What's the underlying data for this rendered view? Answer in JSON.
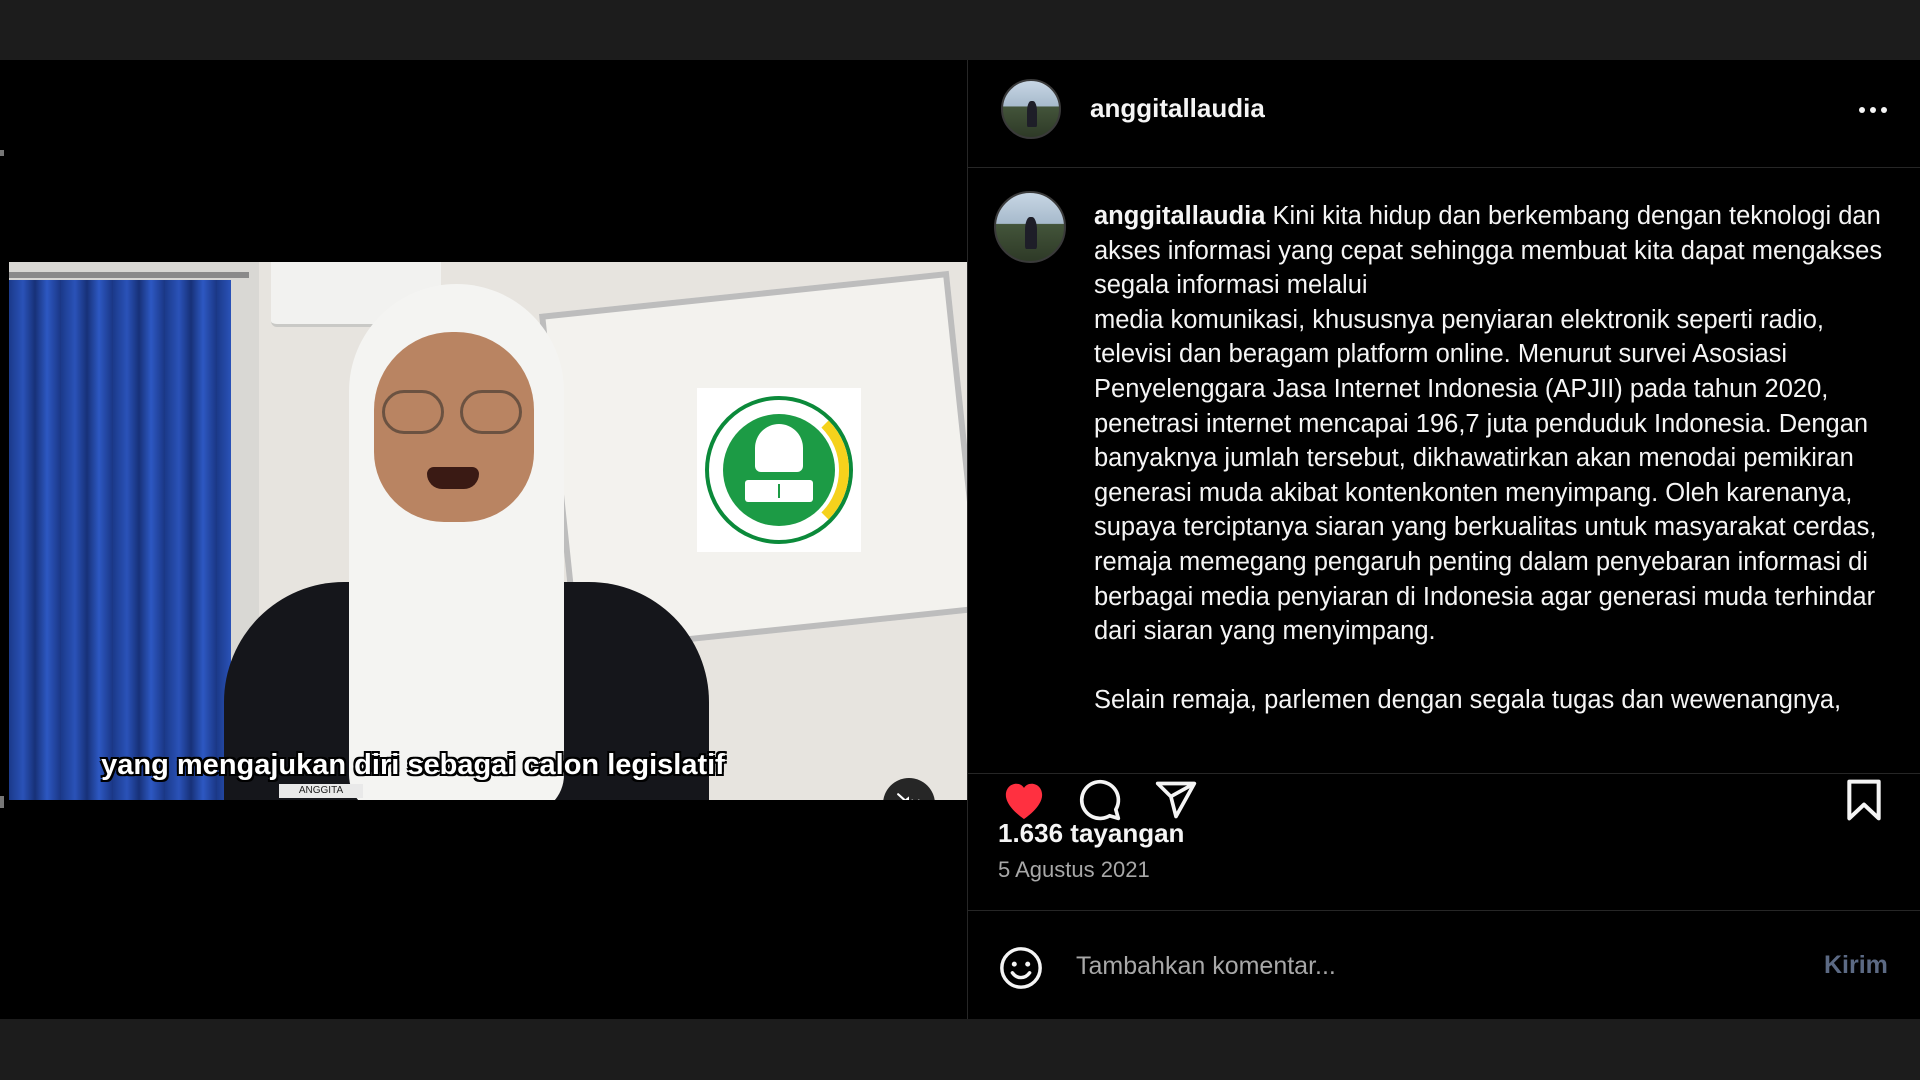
{
  "video": {
    "subtitle": "yang mengajukan diri sebagai calon legislatif",
    "name_tag": "ANGGITA ALLAUDIA",
    "mute_icon": "speaker-muted-icon"
  },
  "post": {
    "username": "anggitallaudia",
    "more_icon": "more-horizontal-icon",
    "caption": {
      "username": "anggitallaudia",
      "paragraph1": "Kini kita hidup dan berkembang dengan teknologi dan akses informasi yang cepat sehingga membuat kita dapat mengakses segala informasi melalui\nmedia komunikasi, khususnya penyiaran elektronik seperti radio, televisi dan beragam platform online. Menurut survei Asosiasi Penyelenggara Jasa Internet Indonesia (APJII) pada tahun 2020, penetrasi internet mencapai 196,7 juta penduduk Indonesia. Dengan banyaknya jumlah tersebut, dikhawatirkan akan menodai pemikiran generasi muda akibat kontenkonten menyimpang. Oleh karenanya, supaya terciptanya siaran yang berkualitas untuk masyarakat cerdas, remaja memegang pengaruh penting dalam penyebaran informasi di berbagai media penyiaran di Indonesia agar generasi muda terhindar dari siaran yang menyimpang.",
      "paragraph2": "Selain remaja, parlemen dengan segala tugas dan wewenangnya,"
    },
    "views": "1.636 tayangan",
    "date": "5 Agustus 2021"
  },
  "actions": {
    "like_icon": "heart-filled-icon",
    "comment_icon": "comment-icon",
    "share_icon": "send-icon",
    "save_icon": "bookmark-icon",
    "like_color": "#ff3040"
  },
  "comment": {
    "emoji_icon": "smiley-icon",
    "placeholder": "Tambahkan komentar...",
    "post_label": "Kirim",
    "post_color": "#5c6a84"
  }
}
